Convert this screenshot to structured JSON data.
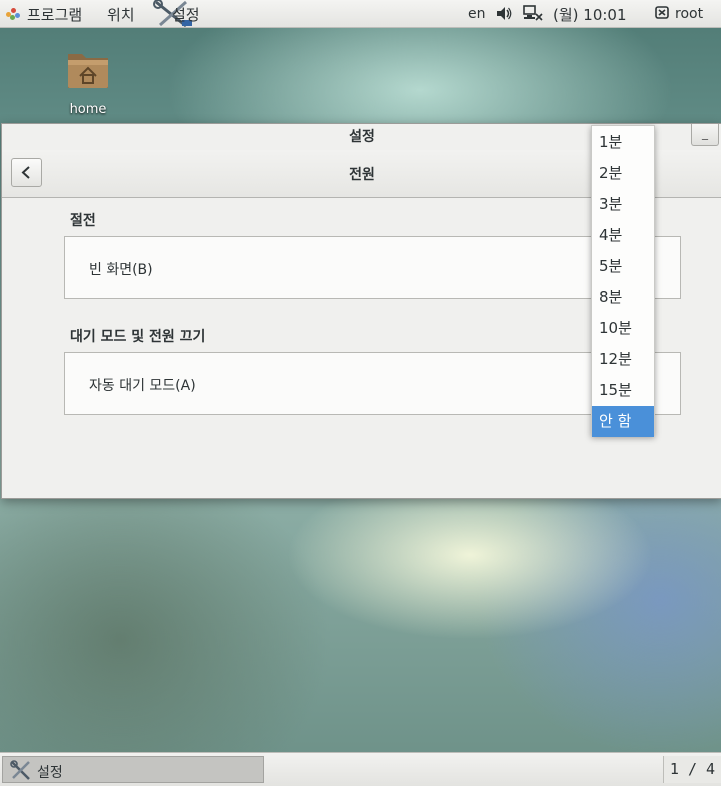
{
  "top_panel": {
    "programs_label": "프로그램",
    "places_label": "위치",
    "app_label": "설정",
    "lang": "en",
    "clock": "(월) 10:01",
    "user": "root"
  },
  "desktop": {
    "home_label": "home"
  },
  "window": {
    "title": "설정",
    "header_title": "전원",
    "sections": [
      {
        "title": "절전",
        "row_label": "빈 화면(B)"
      },
      {
        "title": "대기 모드 및 전원 끄기",
        "row_label": "자동 대기 모드(A)"
      }
    ],
    "minimize_label": "_"
  },
  "dropdown": {
    "options": [
      "1분",
      "2분",
      "3분",
      "4분",
      "5분",
      "8분",
      "10분",
      "12분",
      "15분",
      "안 함"
    ],
    "selected": "안 함"
  },
  "bottom_panel": {
    "task_label": "설정",
    "workspace": "1 / 4"
  },
  "colors": {
    "accent": "#4a90d9",
    "panel": "#e9e9e6",
    "window_bg": "#f0f0ee"
  }
}
